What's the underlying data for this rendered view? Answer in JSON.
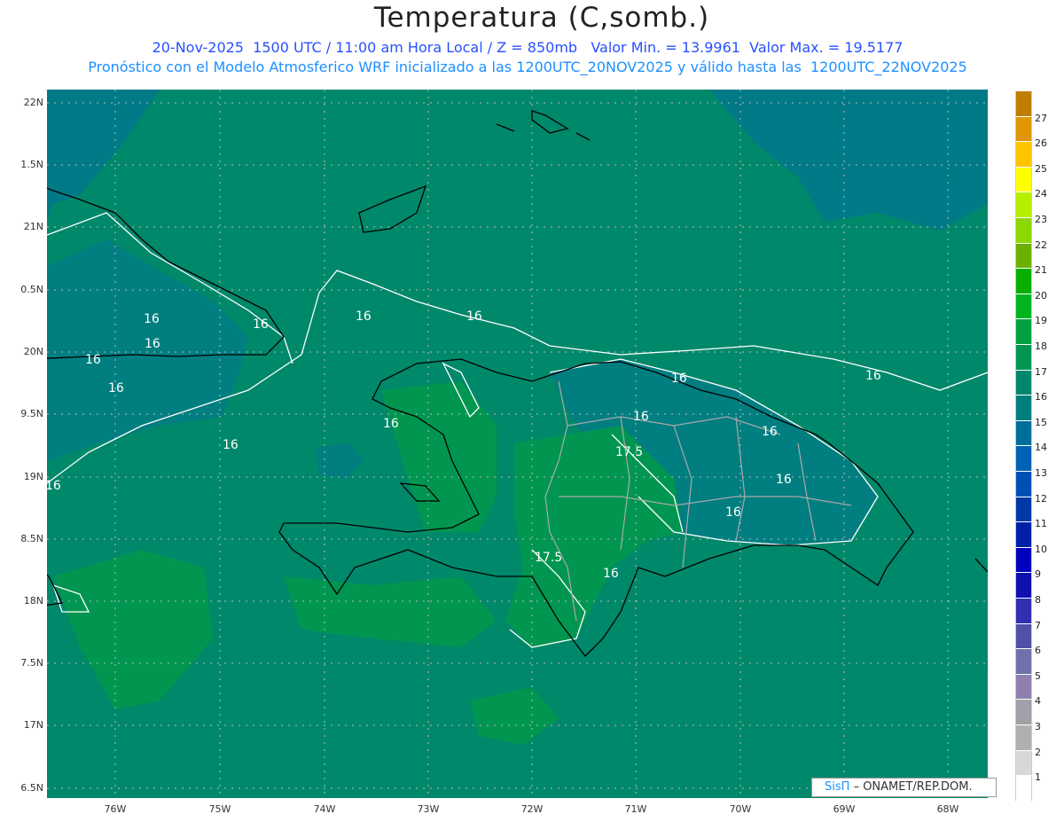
{
  "title": "Temperatura (C,somb.)",
  "subtitle": "20-Nov-2025  1500 UTC / 11:00 am Hora Local / Z = 850mb   Valor Min. = 13.9961  Valor Max. = 19.5177",
  "description": "Pronóstico con el Modelo Atmosferico WRF inicializado a las 1200UTC_20NOV2025 y válido hasta las  1200UTC_22NOV2025",
  "lat_labels": [
    "22N",
    "1.5N",
    "21N",
    "0.5N",
    "20N",
    "9.5N",
    "19N",
    "8.5N",
    "18N",
    "7.5N",
    "17N",
    "6.5N"
  ],
  "lon_labels": [
    "76W",
    "75W",
    "74W",
    "73W",
    "72W",
    "71W",
    "70W",
    "69W",
    "68W"
  ],
  "colorbar": {
    "labels": [
      "27",
      "26",
      "25",
      "24",
      "23",
      "22",
      "21",
      "20",
      "19",
      "18",
      "17",
      "16",
      "15",
      "14",
      "13",
      "12",
      "11",
      "10",
      "9",
      "8",
      "7",
      "6",
      "5",
      "4",
      "3",
      "2",
      "1"
    ],
    "colors": [
      "#bf7e00",
      "#e09600",
      "#ffc400",
      "#ffff00",
      "#b4f000",
      "#8cd800",
      "#6cb000",
      "#08ae00",
      "#00b420",
      "#00a040",
      "#009650",
      "#00886a",
      "#007e7e",
      "#006e9a",
      "#0062b4",
      "#0050b4",
      "#0038a8",
      "#0020a8",
      "#0000c0",
      "#1010b0",
      "#3030b0",
      "#5050a8",
      "#7070aa",
      "#9080b0",
      "#a0a0a8",
      "#b0b0b0",
      "#d8d8d8",
      "#ffffff"
    ]
  },
  "contour_labels": [
    "16",
    "16",
    "16",
    "16",
    "16",
    "16",
    "16",
    "16",
    "16",
    "16",
    "16",
    "16",
    "16",
    "16",
    "16",
    "16",
    "17.5",
    "17.5",
    "16"
  ],
  "credit": {
    "logo": "SisΠ",
    "text": "– ONAMET/REP.DOM."
  }
}
